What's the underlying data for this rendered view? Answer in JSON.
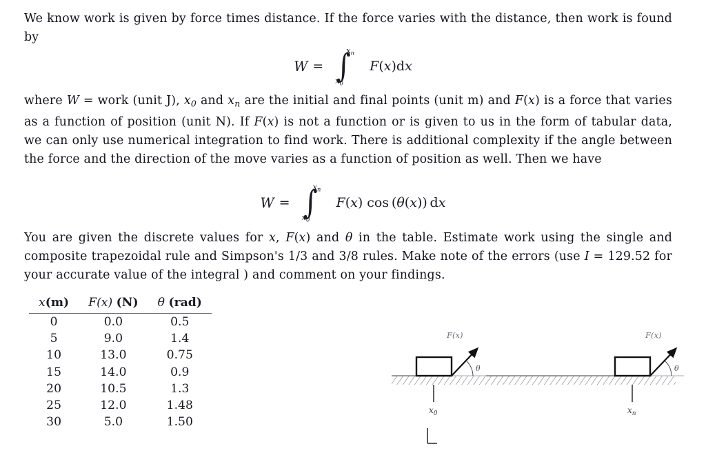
{
  "document": {
    "paragraph1_pre": "We know work is given by force times distance. If the force varies with the distance, then work is found by",
    "equation1": {
      "lhs": "W",
      "relation": "=",
      "integral_lower": "x0",
      "integral_upper": "xn",
      "integrand": "F(x)dx"
    },
    "paragraph2": "where W = work (unit J), x0 and xn are the initial and final points (unit m) and F(x) is a force that varies as a function of position (unit N). If F(x) is not a function or is given to us in the form of tabular data, we can only use numerical integration to find work. There is additional complexity if the angle between the force and the direction of the move varies as a function of position as well. Then we have",
    "equation2": {
      "lhs": "W",
      "relation": "=",
      "integral_lower": "x0",
      "integral_upper": "xn",
      "integrand": "F(x) cos (θ(x)) dx"
    },
    "paragraph3": "You are given the discrete values for x, F(x) and θ in the table. Estimate work using the single and composite trapezoidal rule and Simpson's 1/3 and 3/8 rules. Make note of the errors (use I = 129.52 for your accurate value of the integral ) and comment on your findings.",
    "accurate_integral_value": "129.52"
  },
  "table": {
    "headers": [
      {
        "variable": "x",
        "unit": "(m)"
      },
      {
        "variable": "F(x)",
        "unit": "(N)"
      },
      {
        "variable": "θ",
        "unit": "(rad)"
      }
    ],
    "rows": [
      {
        "x": "0",
        "F": "0.0",
        "theta": "0.5"
      },
      {
        "x": "5",
        "F": "9.0",
        "theta": "1.4"
      },
      {
        "x": "10",
        "F": "13.0",
        "theta": "0.75"
      },
      {
        "x": "15",
        "F": "14.0",
        "theta": "0.9"
      },
      {
        "x": "20",
        "F": "10.5",
        "theta": "1.3"
      },
      {
        "x": "25",
        "F": "12.0",
        "theta": "1.48"
      },
      {
        "x": "30",
        "F": "5.0",
        "theta": "1.50"
      }
    ]
  },
  "figure": {
    "left_panel": {
      "force_label": "F(x)",
      "angle_label": "θ",
      "position_label": "x0"
    },
    "right_panel": {
      "force_label": "F(x)",
      "angle_label": "θ",
      "position_label": "xn"
    }
  },
  "colors": {
    "text": "#14141e",
    "rule": "#6a6a72",
    "figure_stroke": "#111111",
    "figure_faint": "#8b8b93"
  }
}
